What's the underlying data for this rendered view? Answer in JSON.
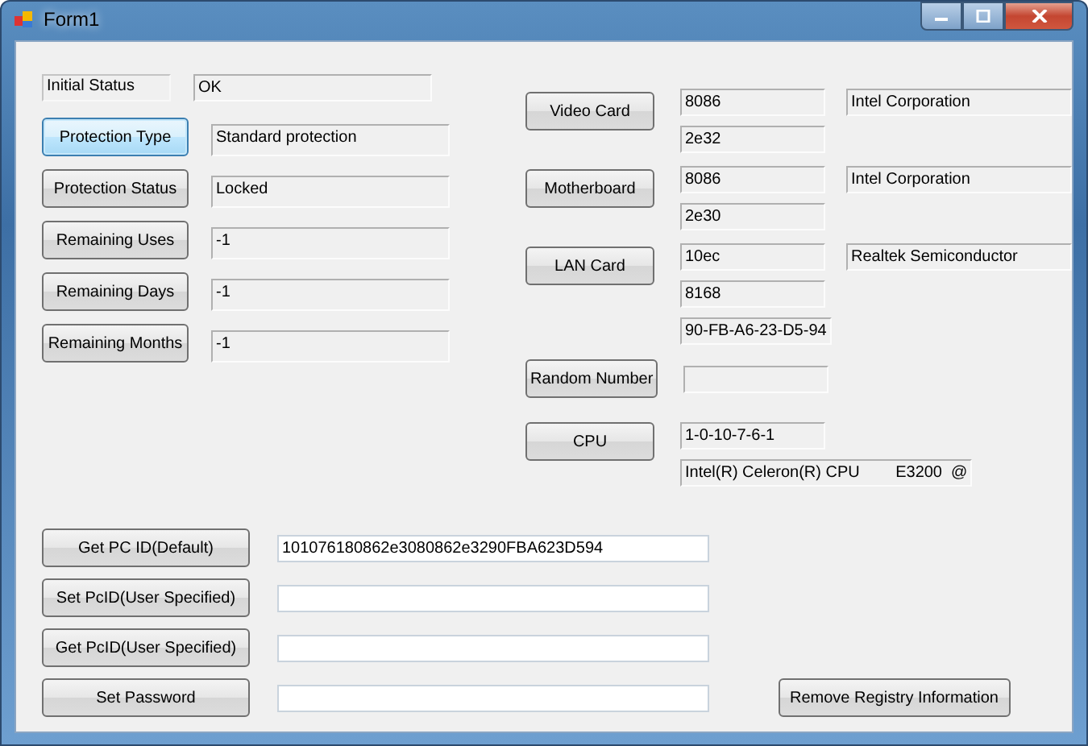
{
  "window": {
    "title": "Form1",
    "controls": [
      {
        "kind": "minimize"
      },
      {
        "kind": "maximize"
      },
      {
        "kind": "close"
      }
    ]
  },
  "status_rows": [
    {
      "kind": "label",
      "label": "Initial Status",
      "value": "OK"
    },
    {
      "kind": "button",
      "label": "Protection Type",
      "value": "Standard protection",
      "focused": true
    },
    {
      "kind": "button",
      "label": "Protection Status",
      "value": "Locked",
      "focused": false
    },
    {
      "kind": "button",
      "label": "Remaining Uses",
      "value": "-1",
      "focused": false
    },
    {
      "kind": "button",
      "label": "Remaining Days",
      "value": "-1",
      "focused": false
    },
    {
      "kind": "button",
      "label": "Remaining Months",
      "value": "-1",
      "focused": false
    }
  ],
  "hardware": [
    {
      "button": "Video Card",
      "rows": [
        [
          {
            "text": "8086"
          },
          {
            "text": "Intel Corporation"
          }
        ],
        [
          {
            "text": "2e32"
          }
        ]
      ]
    },
    {
      "button": "Motherboard",
      "rows": [
        [
          {
            "text": "8086"
          },
          {
            "text": "Intel Corporation"
          }
        ],
        [
          {
            "text": "2e30"
          }
        ]
      ]
    },
    {
      "button": "LAN Card",
      "rows": [
        [
          {
            "text": "10ec"
          },
          {
            "text": "Realtek Semiconductor"
          }
        ],
        [
          {
            "text": "8168"
          }
        ],
        [
          {
            "text": "90-FB-A6-23-D5-94"
          }
        ]
      ]
    },
    {
      "button": "Random Number",
      "rows": [
        [
          {}
        ]
      ]
    },
    {
      "button": "CPU",
      "rows": [
        [
          {
            "text": "1-0-10-7-6-1"
          }
        ],
        [
          {
            "text": "Intel(R) Celeron(R) CPU        E3200  @"
          }
        ]
      ]
    }
  ],
  "pc_id_rows": [
    {
      "button": "Get PC ID(Default)",
      "value": "101076180862e3080862e3290FBA623D594"
    },
    {
      "button": "Set PcID(User Specified)"
    },
    {
      "button": "Get PcID(User Specified)"
    },
    {
      "button": "Set Password"
    }
  ],
  "remove_button": "Remove Registry Information"
}
